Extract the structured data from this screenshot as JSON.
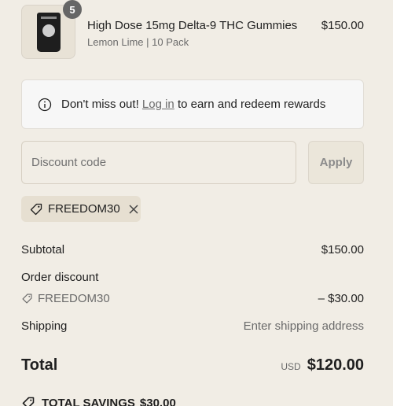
{
  "product": {
    "title": "High Dose 15mg Delta-9 THC Gummies",
    "variant": "Lemon Lime | 10 Pack",
    "price": "$150.00",
    "quantity": "5",
    "image_icon": "gummies-pouch-image"
  },
  "rewards": {
    "prefix": "Don't miss out! ",
    "link": "Log in",
    "suffix": " to earn and redeem rewards",
    "icon": "info-icon"
  },
  "discount": {
    "placeholder": "Discount code",
    "apply_label": "Apply",
    "applied_code": "FREEDOM30"
  },
  "summary": {
    "subtotal_label": "Subtotal",
    "subtotal_value": "$150.00",
    "order_discount_label": "Order discount",
    "order_discount_code": "FREEDOM30",
    "order_discount_value": "– $30.00",
    "shipping_label": "Shipping",
    "shipping_value": "Enter shipping address",
    "total_label": "Total",
    "total_currency": "USD",
    "total_value": "$120.00",
    "savings_label": "TOTAL SAVINGS",
    "savings_value": "$30.00"
  },
  "colors": {
    "background": "#f1ede5",
    "chip": "#e6dfd1",
    "muted_text": "#6b6b6b"
  }
}
